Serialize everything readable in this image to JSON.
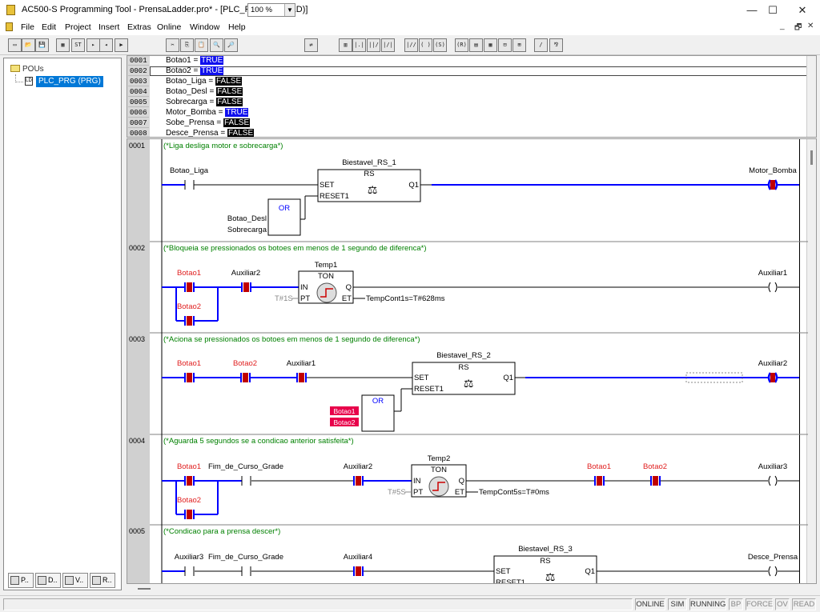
{
  "window": {
    "title": "AC500-S Programming Tool - PrensaLadder.pro* - [PLC_PRG (PRG-LD)]",
    "minimize": "—",
    "maximize": "☐",
    "close": "✕"
  },
  "menu": [
    "File",
    "Edit",
    "Project",
    "Insert",
    "Extras",
    "Online",
    "Window",
    "Help"
  ],
  "mdi_controls": [
    "_",
    "🗗",
    "✕"
  ],
  "toolbar": {
    "zoom": "100 %",
    "icons": [
      "new-file-icon",
      "open-file-icon",
      "save-icon",
      "build-icon",
      "stop-icon",
      "login-icon",
      "logout-icon",
      "run-icon",
      "cut-icon",
      "copy-icon",
      "paste-icon",
      "find-icon",
      "find-next-icon",
      "replace-icon",
      "ladder-view-icon",
      "contact-icon",
      "parallel-contact-icon",
      "negated-contact-icon",
      "parallel-negated-contact-icon",
      "coil-icon",
      "set-coil-icon",
      "reset-coil-icon",
      "box-icon",
      "box-with-en-icon",
      "jump-icon",
      "return-icon",
      "comment-icon",
      "network-icon"
    ],
    "icon_glyphs": [
      "▭",
      "📂",
      "💾",
      "▦",
      "ST",
      "▸",
      "◂",
      "▶",
      "✂",
      "⎘",
      "📋",
      "🔍",
      "🔎",
      "⇄",
      "▥",
      "|.|",
      "||/",
      "|/|",
      "|//",
      "( )",
      "(S)",
      "(R)",
      "▤",
      "▦",
      "⊟",
      "⊞",
      "/",
      "⅋"
    ]
  },
  "tree": {
    "root": "POUs",
    "item": "PLC_PRG (PRG)"
  },
  "left_tabs": [
    "P..",
    "D..",
    "V..",
    "R.."
  ],
  "variables": [
    {
      "num": "0001",
      "name": "Botao1 = ",
      "value": "TRUE",
      "state": "true"
    },
    {
      "num": "0002",
      "name": "Botao2 = ",
      "value": "TRUE",
      "state": "true"
    },
    {
      "num": "0003",
      "name": "Botao_Liga = ",
      "value": "FALSE",
      "state": "false"
    },
    {
      "num": "0004",
      "name": "Botao_Desl = ",
      "value": "FALSE",
      "state": "false"
    },
    {
      "num": "0005",
      "name": "Sobrecarga = ",
      "value": "FALSE",
      "state": "false"
    },
    {
      "num": "0006",
      "name": "Motor_Bomba = ",
      "value": "TRUE",
      "state": "true"
    },
    {
      "num": "0007",
      "name": "Sobe_Prensa = ",
      "value": "FALSE",
      "state": "false"
    },
    {
      "num": "0008",
      "name": "Desce_Prensa = ",
      "value": "FALSE",
      "state": "false"
    }
  ],
  "networks": {
    "n1": {
      "num": "0001",
      "comment": "(*Liga desliga motor e sobrecarga*)",
      "contact": "Botao_Liga",
      "fb_instance": "Biestavel_RS_1",
      "fb_type": "RS",
      "pin_set": "SET",
      "pin_reset": "RESET1",
      "pin_q1": "Q1",
      "or_label": "OR",
      "or_in1": "Botao_Desl",
      "or_in2": "Sobrecarga",
      "coil": "Motor_Bomba"
    },
    "n2": {
      "num": "0002",
      "comment": "(*Bloqueia se pressionados os botoes em menos de 1 segundo de diferenca*)",
      "c1": "Botao1",
      "c2": "Botao2",
      "c3": "Auxiliar2",
      "fb_instance": "Temp1",
      "fb_type": "TON",
      "pin_in": "IN",
      "pin_pt": "PT",
      "pin_q": "Q",
      "pin_et": "ET",
      "pt_value": "T#1S",
      "et_var": "TempCont1s=T#628ms",
      "coil": "Auxiliar1"
    },
    "n3": {
      "num": "0003",
      "comment": "(*Aciona se pressionados os botoes em menos de 1 segundo de diferenca*)",
      "c1": "Botao1",
      "c2": "Botao2",
      "c3": "Auxiliar1",
      "fb_instance": "Biestavel_RS_2",
      "fb_type": "RS",
      "pin_set": "SET",
      "pin_reset": "RESET1",
      "pin_q1": "Q1",
      "or_label": "OR",
      "or_in1": "Botao1",
      "or_in2": "Botao2",
      "coil": "Auxiliar2"
    },
    "n4": {
      "num": "0004",
      "comment": "(*Aguarda 5 segundos se a condicao anterior satisfeita*)",
      "c1": "Botao1",
      "c2": "Botao2",
      "c3": "Fim_de_Curso_Grade",
      "c4": "Auxiliar2",
      "fb_instance": "Temp2",
      "fb_type": "TON",
      "pin_in": "IN",
      "pin_pt": "PT",
      "pin_q": "Q",
      "pin_et": "ET",
      "pt_value": "T#5S",
      "et_var": "TempCont5s=T#0ms",
      "c5": "Botao1",
      "c6": "Botao2",
      "coil": "Auxiliar3"
    },
    "n5": {
      "num": "0005",
      "comment": "(*Condicao para a prensa descer*)",
      "c1": "Auxiliar3",
      "c2": "Fim_de_Curso_Grade",
      "c3": "Auxiliar4",
      "fb_instance": "Biestavel_RS_3",
      "fb_type": "RS",
      "pin_set": "SET",
      "pin_reset": "RESET1",
      "pin_q1": "Q1",
      "coil": "Desce_Prensa"
    }
  },
  "status": [
    "ONLINE",
    "SIM",
    "RUNNING",
    "BP",
    "FORCE",
    "OV",
    "READ"
  ],
  "status_active": [
    true,
    true,
    true,
    false,
    false,
    false,
    false
  ],
  "colors": {
    "energized": "#0000ff",
    "rung": "#0000ff",
    "comment": "#008000",
    "true_var": "#e02020",
    "contact_fill": "#c00000"
  }
}
